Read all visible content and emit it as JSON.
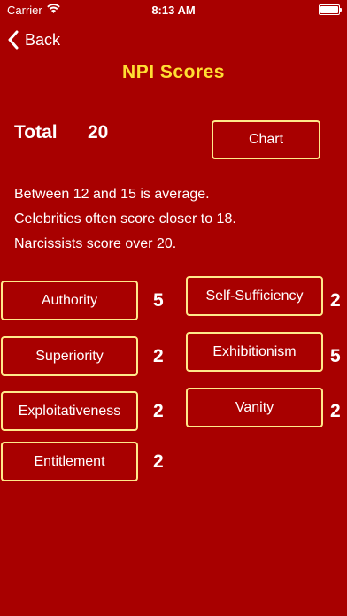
{
  "status_bar": {
    "carrier": "Carrier",
    "wifi_icon": "wifi-icon",
    "time": "8:13 AM",
    "battery_icon": "battery-icon"
  },
  "nav": {
    "back_label": "Back",
    "back_icon": "chevron-left-icon"
  },
  "title": "NPI Scores",
  "total": {
    "label": "Total",
    "value": "20"
  },
  "chart_button_label": "Chart",
  "info_lines": [
    "Between 12 and 15 is average.",
    "Celebrities often score closer to 18.",
    "Narcissists score over 20."
  ],
  "left_traits": [
    {
      "label": "Authority",
      "score": "5"
    },
    {
      "label": "Superiority",
      "score": "2"
    },
    {
      "label": "Exploitativeness",
      "score": "2"
    },
    {
      "label": "Entitlement",
      "score": "2"
    }
  ],
  "right_traits": [
    {
      "label": "Self-Sufficiency",
      "score": "2"
    },
    {
      "label": "Exhibitionism",
      "score": "5"
    },
    {
      "label": "Vanity",
      "score": "2"
    }
  ],
  "colors": {
    "background": "#a80000",
    "title": "#ffde33",
    "button_border": "#ffe98a",
    "text": "#ffffff"
  }
}
